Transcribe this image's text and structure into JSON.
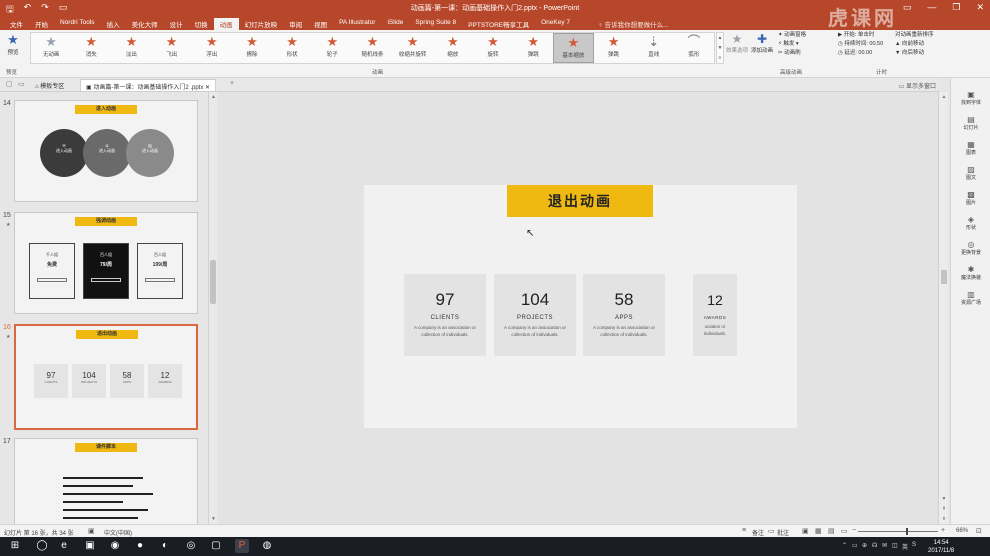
{
  "window": {
    "title": "动画篇-第一课：动画基础操作入门2.pptx - PowerPoint",
    "qa_icons": [
      "save-icon",
      "undo-icon",
      "redo-icon",
      "present-icon"
    ],
    "win_controls": [
      "minimize-icon",
      "restore-icon",
      "close-icon"
    ],
    "ribbon_collapse": "▭"
  },
  "tabs": [
    {
      "label": "文件"
    },
    {
      "label": "开始"
    },
    {
      "label": "Nordri Tools"
    },
    {
      "label": "插入"
    },
    {
      "label": "美化大师"
    },
    {
      "label": "设计"
    },
    {
      "label": "切换"
    },
    {
      "label": "动画",
      "active": true
    },
    {
      "label": "幻灯片放映"
    },
    {
      "label": "审阅"
    },
    {
      "label": "视图"
    },
    {
      "label": "PA Illustrator"
    },
    {
      "label": "iSlide"
    },
    {
      "label": "Spring Suite 8"
    },
    {
      "label": "PPTSTORE畅享工具"
    },
    {
      "label": "OneKey 7"
    }
  ],
  "tellme": "♀ 告诉我你想要做什么...",
  "ribbon": {
    "preview_label": "预览",
    "animations": [
      {
        "label": "无动画",
        "color": "#9aa3ad"
      },
      {
        "label": "消失",
        "color": "#d05a3a"
      },
      {
        "label": "淡出",
        "color": "#d05a3a"
      },
      {
        "label": "飞出",
        "color": "#d05a3a"
      },
      {
        "label": "浮出",
        "color": "#d05a3a"
      },
      {
        "label": "擦除",
        "color": "#d05a3a"
      },
      {
        "label": "形状",
        "color": "#d05a3a"
      },
      {
        "label": "轮子",
        "color": "#d05a3a"
      },
      {
        "label": "随机线条",
        "color": "#d05a3a"
      },
      {
        "label": "收缩并旋转",
        "color": "#d05a3a"
      },
      {
        "label": "缩放",
        "color": "#d05a3a"
      },
      {
        "label": "旋转",
        "color": "#d05a3a"
      },
      {
        "label": "弹跳",
        "color": "#d05a3a"
      },
      {
        "label": "基本缩放",
        "color": "#d05a3a",
        "selected": true
      },
      {
        "label": "弹跳",
        "color": "#d05a3a"
      },
      {
        "label": "直线",
        "color": "#777777"
      },
      {
        "label": "弧形",
        "color": "#777777"
      }
    ],
    "gallery_scroll": "▲",
    "effect_options": "效果选项",
    "add_animation": "添加动画",
    "advanced": [
      "✦ 动画窗格",
      "⚡ 触发 ▾",
      "✂ 动画刷"
    ],
    "timing": [
      "▶ 开始: 单击时",
      "◷ 持续时间: 00.50",
      "◷ 延迟: 00.00"
    ],
    "reorder": [
      "对动画重新排序",
      "▲ 向前移动",
      "▼ 向后移动"
    ],
    "group_labels": [
      "预览",
      "动画",
      "高级动画",
      "计时"
    ]
  },
  "docbar": {
    "tabs": [
      {
        "label": "模板专区"
      },
      {
        "label": "动画篇-第一课：动画基础操作入门2 .pptx",
        "active": true
      }
    ],
    "add": "+",
    "right": "▭ 显示多窗口"
  },
  "thumbnails": [
    {
      "num": "14",
      "title": "进入动画",
      "items": [
        "进入动画",
        "进入动画",
        "进入动画"
      ]
    },
    {
      "num": "15",
      "title": "强调动画",
      "items": [
        {
          "a": "千人组",
          "b": "免费"
        },
        {
          "a": "百人组",
          "b": "79/周"
        },
        {
          "a": "百人组",
          "b": "199/周"
        }
      ]
    },
    {
      "num": "16",
      "title": "退出动画",
      "items": [
        {
          "n": "97",
          "l": "CLIENTS"
        },
        {
          "n": "104",
          "l": "PROJECTS"
        },
        {
          "n": "58",
          "l": "APPS"
        },
        {
          "n": "12",
          "l": "AWARDS"
        }
      ]
    },
    {
      "num": "17",
      "title": "课件脚本"
    }
  ],
  "slide": {
    "title": "退出动画",
    "stats": [
      {
        "num": "97",
        "label": "CLIENTS",
        "desc": "A company is an association or collection of individuals."
      },
      {
        "num": "104",
        "label": "PROJECTS",
        "desc": "A company is an association or collection of individuals."
      },
      {
        "num": "58",
        "label": "APPS",
        "desc": "A company is an association or collection of individuals."
      },
      {
        "num": "12",
        "label": "AWARDS",
        "desc": "ociation or individuals."
      }
    ]
  },
  "rightpane": [
    {
      "icon": "▣",
      "label": "找到字体"
    },
    {
      "icon": "▤",
      "label": "幻灯片"
    },
    {
      "icon": "▦",
      "label": "图表"
    },
    {
      "icon": "▨",
      "label": "图文"
    },
    {
      "icon": "▩",
      "label": "图片"
    },
    {
      "icon": "◈",
      "label": "形状"
    },
    {
      "icon": "◎",
      "label": "更换背景"
    },
    {
      "icon": "✱",
      "label": "魔法换装"
    },
    {
      "icon": "▥",
      "label": "资源广场"
    }
  ],
  "status": {
    "slide_info": "幻灯片 第 16 张，共 34 张",
    "language": "中文(中国)",
    "notes": "备注",
    "comments": "批注",
    "zoom": "66%"
  },
  "taskbar": {
    "apps": [
      "⊞",
      "◯",
      "e",
      "▣",
      "◉",
      "●",
      "◐",
      "◎",
      "▢",
      "P",
      "◍"
    ],
    "tray": [
      "⌃",
      "▭",
      "⊕",
      "☊",
      "✉",
      "◫",
      "英",
      "S"
    ],
    "time": "14:54",
    "date": "2017/11/8"
  },
  "watermark": "虎课网"
}
